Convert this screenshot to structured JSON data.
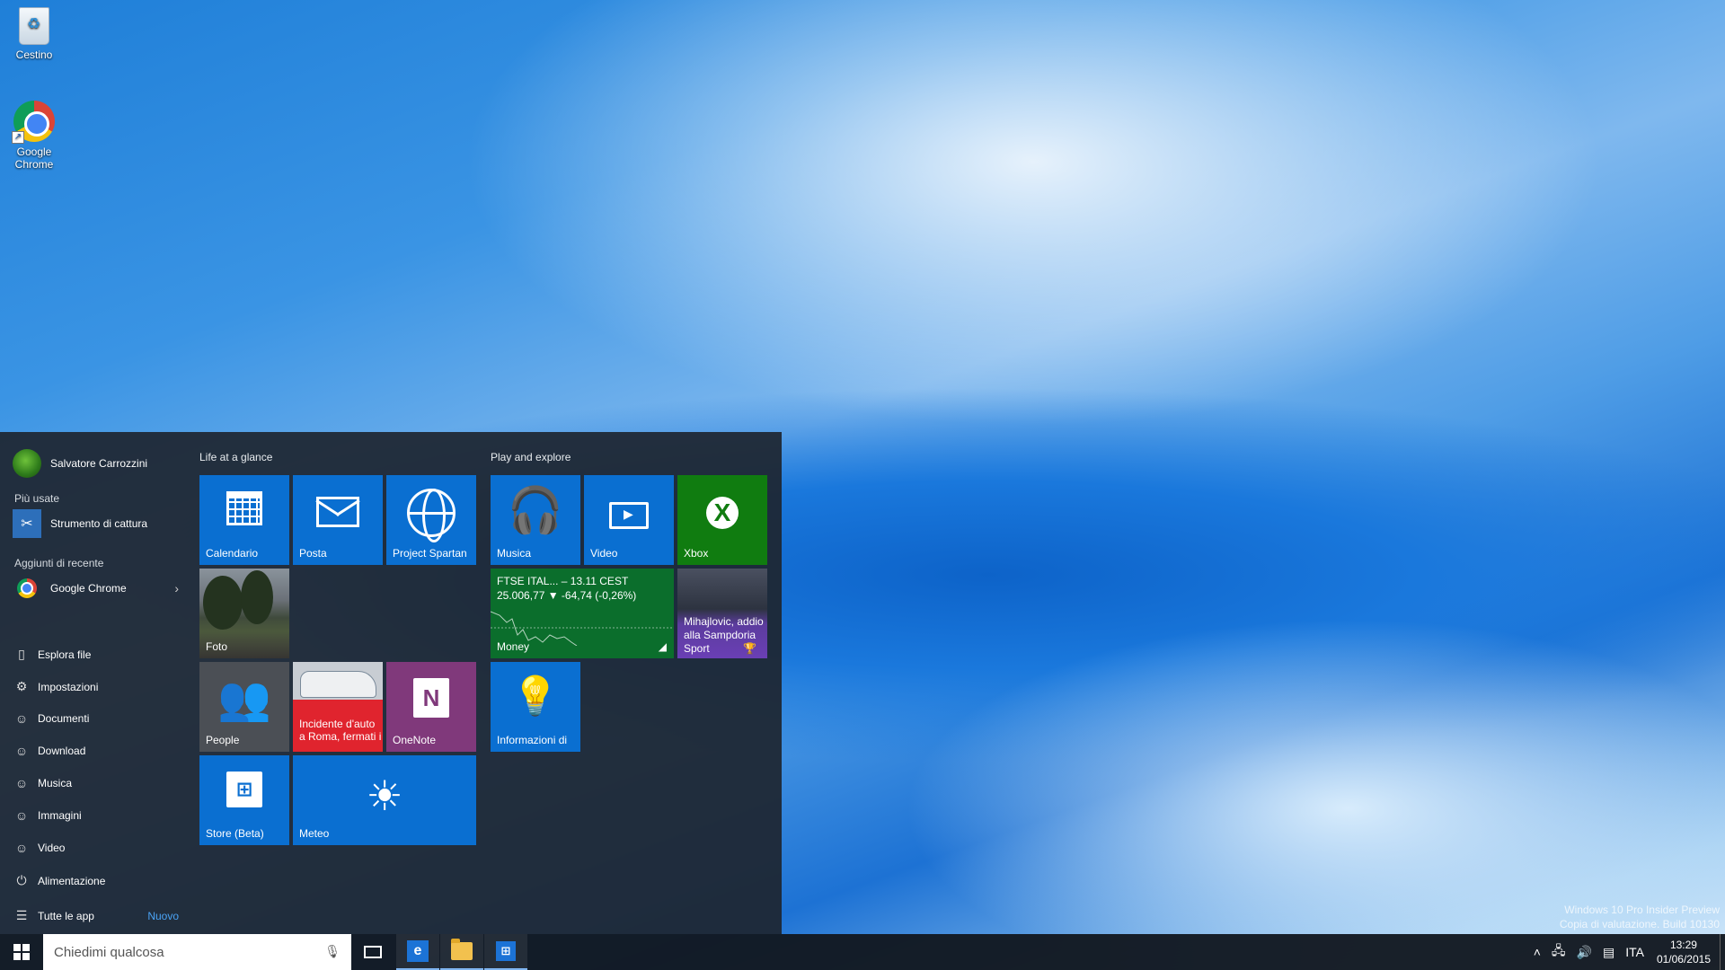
{
  "desktop": {
    "icons": [
      {
        "label": "Cestino",
        "icon": "recycle-bin-icon"
      },
      {
        "label": "Google Chrome",
        "icon": "chrome-icon"
      }
    ],
    "watermark_line1": "Windows 10 Pro Insider Preview",
    "watermark_line2": "Copia di valutazione. Build 10130"
  },
  "start_menu": {
    "user_name": "Salvatore Carrozzini",
    "most_used_label": "Più usate",
    "most_used": [
      {
        "label": "Strumento di cattura",
        "icon": "snipping-tool-icon"
      }
    ],
    "recent_label": "Aggiunti di recente",
    "recent": [
      {
        "label": "Google Chrome",
        "icon": "chrome-icon"
      }
    ],
    "nav": [
      {
        "label": "Esplora file",
        "icon": "file-explorer-icon"
      },
      {
        "label": "Impostazioni",
        "icon": "gear-icon"
      },
      {
        "label": "Documenti",
        "icon": "folder-icon"
      },
      {
        "label": "Download",
        "icon": "folder-icon"
      },
      {
        "label": "Musica",
        "icon": "folder-icon"
      },
      {
        "label": "Immagini",
        "icon": "folder-icon"
      },
      {
        "label": "Video",
        "icon": "folder-icon"
      },
      {
        "label": "Alimentazione",
        "icon": "power-icon"
      },
      {
        "label": "Tutte le app",
        "icon": "list-icon"
      }
    ],
    "new_badge": "Nuovo",
    "groups": {
      "life_title": "Life at a glance",
      "play_title": "Play and explore"
    },
    "tiles": {
      "calendario": "Calendario",
      "posta": "Posta",
      "spartan": "Project Spartan",
      "foto": "Foto",
      "people": "People",
      "news": "Incidente d'auto a Roma, fermati i",
      "onenote": "OneNote",
      "store": "Store (Beta)",
      "meteo": "Meteo",
      "musica": "Musica",
      "video": "Video",
      "xbox": "Xbox",
      "money_line1": "FTSE ITAL... – 13.11 CEST",
      "money_line2": "25.006,77 ▼ -64,74 (-0,26%)",
      "money": "Money",
      "sport_headline": "Mihajlovic, addio alla Sampdoria",
      "sport": "Sport",
      "info": "Informazioni di"
    },
    "tile_colors": {
      "blue": "#0a6fd1",
      "xbox_green": "#107c10",
      "money_green": "#0b6e2c",
      "onenote_purple": "#80397b",
      "news_red": "#e0242e"
    }
  },
  "taskbar": {
    "search_placeholder": "Chiedimi qualcosa",
    "pinned": [
      "task-view-icon",
      "internet-explorer-icon",
      "file-explorer-icon",
      "store-icon"
    ],
    "language": "ITA",
    "time": "13:29",
    "date": "01/06/2015"
  }
}
